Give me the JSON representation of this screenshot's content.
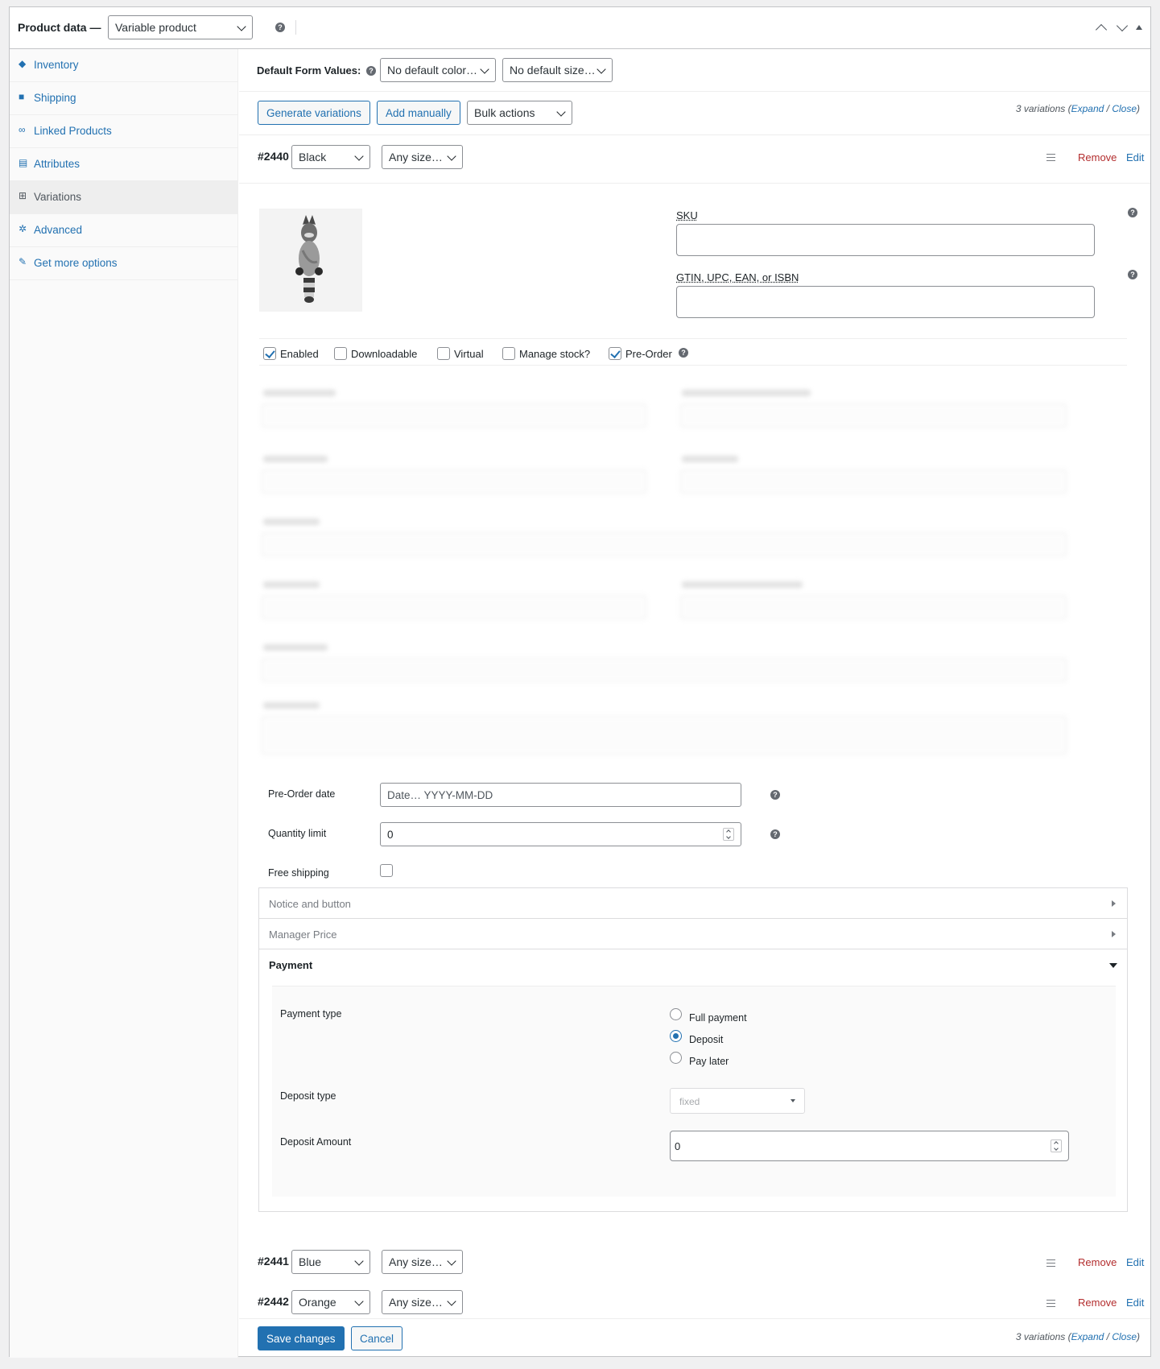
{
  "header": {
    "title": "Product data —",
    "product_type": "Variable product",
    "help": "?"
  },
  "sidebar": {
    "items": [
      {
        "label": "Inventory",
        "icon": "tag-icon"
      },
      {
        "label": "Shipping",
        "icon": "truck-icon"
      },
      {
        "label": "Linked Products",
        "icon": "link-icon"
      },
      {
        "label": "Attributes",
        "icon": "list-icon"
      },
      {
        "label": "Variations",
        "icon": "grid-icon",
        "active": true
      },
      {
        "label": "Advanced",
        "icon": "gear-icon"
      },
      {
        "label": "Get more options",
        "icon": "plugin-icon"
      }
    ]
  },
  "defaults": {
    "label": "Default Form Values:",
    "color": "No default color…",
    "size": "No default size…"
  },
  "toolbar": {
    "generate": "Generate variations",
    "add_manually": "Add manually",
    "bulk_actions": "Bulk actions",
    "count_text": "3 variations",
    "expand": "Expand",
    "slash": " / ",
    "close": "Close"
  },
  "variations": [
    {
      "id": "#2440",
      "color": "Black",
      "size": "Any size…",
      "remove": "Remove",
      "edit": "Edit"
    },
    {
      "id": "#2441",
      "color": "Blue",
      "size": "Any size…",
      "remove": "Remove",
      "edit": "Edit"
    },
    {
      "id": "#2442",
      "color": "Orange",
      "size": "Any size…",
      "remove": "Remove",
      "edit": "Edit"
    }
  ],
  "detail": {
    "sku_label": "SKU",
    "sku_value": "",
    "gtin_label": "GTIN, UPC, EAN, or ISBN",
    "gtin_value": "",
    "checks": [
      {
        "label": "Enabled",
        "checked": true
      },
      {
        "label": "Downloadable",
        "checked": false
      },
      {
        "label": "Virtual",
        "checked": false
      },
      {
        "label": "Manage stock?",
        "checked": false
      },
      {
        "label": "Pre-Order",
        "checked": true
      }
    ],
    "preorder_date_label": "Pre-Order date",
    "preorder_date_placeholder": "Date… YYYY-MM-DD",
    "quantity_limit_label": "Quantity limit",
    "quantity_limit_value": "0",
    "free_shipping_label": "Free shipping",
    "free_shipping_checked": false
  },
  "accordion": {
    "notice": "Notice and button",
    "manager_price": "Manager Price",
    "payment": "Payment"
  },
  "payment": {
    "type_label": "Payment type",
    "options": [
      {
        "label": "Full payment",
        "selected": false
      },
      {
        "label": "Deposit",
        "selected": true
      },
      {
        "label": "Pay later",
        "selected": false
      }
    ],
    "deposit_type_label": "Deposit type",
    "deposit_type_value": "fixed",
    "deposit_amount_label": "Deposit Amount",
    "deposit_amount_value": "0"
  },
  "footer": {
    "save": "Save changes",
    "cancel": "Cancel"
  },
  "colors": {
    "link": "#2271b1",
    "remove": "#b32d2e",
    "border": "#c3c4c7"
  }
}
